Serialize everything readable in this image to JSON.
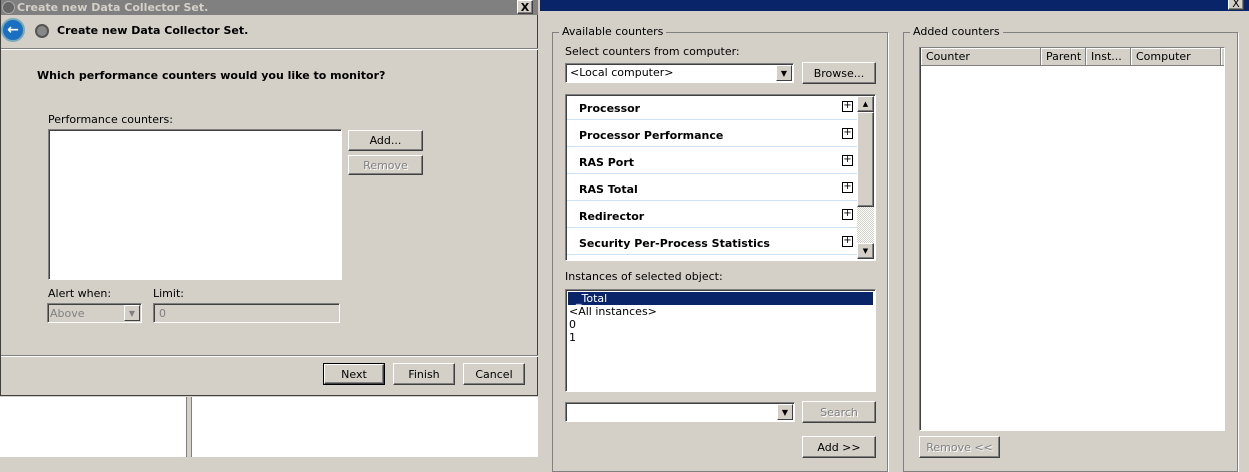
{
  "wizard": {
    "title": "Create new Data Collector Set.",
    "header": "Create new Data Collector Set.",
    "question": "Which performance counters would you like to monitor?",
    "perf_counters_label": "Performance counters:",
    "add": "Add...",
    "remove": "Remove",
    "alert_when_label": "Alert when:",
    "alert_when_value": "Above",
    "limit_label": "Limit:",
    "limit_value": "0",
    "next": "Next",
    "finish": "Finish",
    "cancel": "Cancel",
    "close": "X"
  },
  "addCounters": {
    "close": "X",
    "available_label": "Available counters",
    "select_from_label": "Select counters from computer:",
    "computer_value": "<Local computer>",
    "browse": "Browse...",
    "counters": [
      "Processor",
      "Processor Performance",
      "RAS Port",
      "RAS Total",
      "Redirector",
      "Security Per-Process Statistics"
    ],
    "instances_label": "Instances of selected object:",
    "instances": [
      "_Total",
      "<All instances>",
      "0",
      "1"
    ],
    "search": "Search",
    "add": "Add >>",
    "added_label": "Added counters",
    "columns": [
      "Counter",
      "Parent",
      "Inst...",
      "Computer"
    ],
    "remove": "Remove <<"
  }
}
